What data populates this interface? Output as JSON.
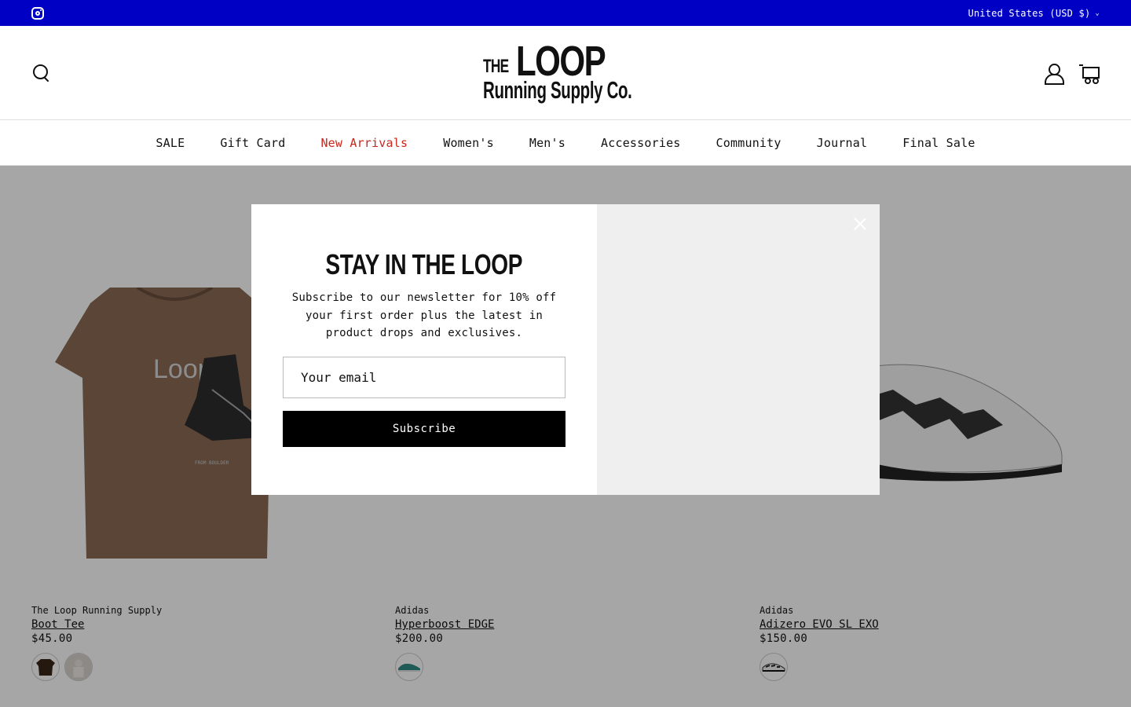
{
  "announcement": {
    "instagram_icon": "instagram-icon",
    "country_selector": "United States (USD $)"
  },
  "header": {
    "logo": {
      "line1_small": "THE",
      "line1_big": "LOOP",
      "line2": "Running Supply Co."
    },
    "icons": [
      "search-icon",
      "account-icon",
      "cart-icon"
    ]
  },
  "nav": {
    "items": [
      {
        "label": "SALE"
      },
      {
        "label": "Gift Card"
      },
      {
        "label": "New Arrivals",
        "highlight": "#c8261d"
      },
      {
        "label": "Women's"
      },
      {
        "label": "Men's"
      },
      {
        "label": "Accessories"
      },
      {
        "label": "Community"
      },
      {
        "label": "Journal"
      },
      {
        "label": "Final Sale"
      }
    ]
  },
  "products": [
    {
      "brand": "The Loop Running Supply",
      "title": "Boot Tee",
      "price": "$45.00",
      "swatches": 2
    },
    {
      "brand": "Adidas",
      "title": "Hyperboost EDGE",
      "price": "$200.00",
      "swatches": 1
    },
    {
      "brand": "Adidas",
      "title": "Adizero EVO SL EXO",
      "price": "$150.00",
      "swatches": 1
    }
  ],
  "modal": {
    "heading": "STAY IN THE LOOP",
    "body": "Subscribe to our newsletter for 10% off your first order plus the latest in product drops and exclusives.",
    "email_placeholder": "Your email",
    "button_label": "Subscribe",
    "close_icon": "close-icon"
  },
  "colors": {
    "announcement_bg": "#0000c4",
    "highlight_nav": "#c8261d",
    "button_bg": "#000000"
  }
}
